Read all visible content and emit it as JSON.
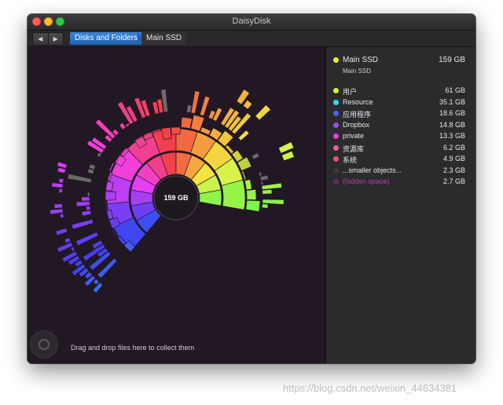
{
  "window": {
    "title": "DaisyDisk"
  },
  "toolbar": {
    "back_label": "◀",
    "forward_label": "▶",
    "breadcrumb": [
      "Disks and Folders",
      "Main SSD"
    ]
  },
  "chart": {
    "center_label": "159 GB"
  },
  "sidebar": {
    "disk": {
      "name": "Main SSD",
      "size": "159  GB",
      "color": "#e8f32b",
      "sub": "Main SSD"
    },
    "items": [
      {
        "label": "用户",
        "size": "61    GB",
        "color": "#d8f035"
      },
      {
        "label": "Resource",
        "size": "35.1  GB",
        "color": "#34d9f0"
      },
      {
        "label": "应用程序",
        "size": "18.6  GB",
        "color": "#4a63f0"
      },
      {
        "label": "Dropbox",
        "size": "14.8  GB",
        "color": "#9b4df0"
      },
      {
        "label": "private",
        "size": "13.3  GB",
        "color": "#ee3fd6"
      },
      {
        "label": "资源库",
        "size": "6.2  GB",
        "color": "#f05aa0"
      },
      {
        "label": "系统",
        "size": "4.9  GB",
        "color": "#f0506e"
      },
      {
        "label": "...smaller objects...",
        "size": "2.3  GB",
        "color": "#3a3a3c"
      },
      {
        "label": "(hidden space)",
        "size": "2.7  GB",
        "color": "#6a2a63"
      }
    ]
  },
  "footer": {
    "drop_hint": "Drag and drop files here to collect them"
  },
  "watermark": "https://blog.csdn.net/weixin_44634381"
}
